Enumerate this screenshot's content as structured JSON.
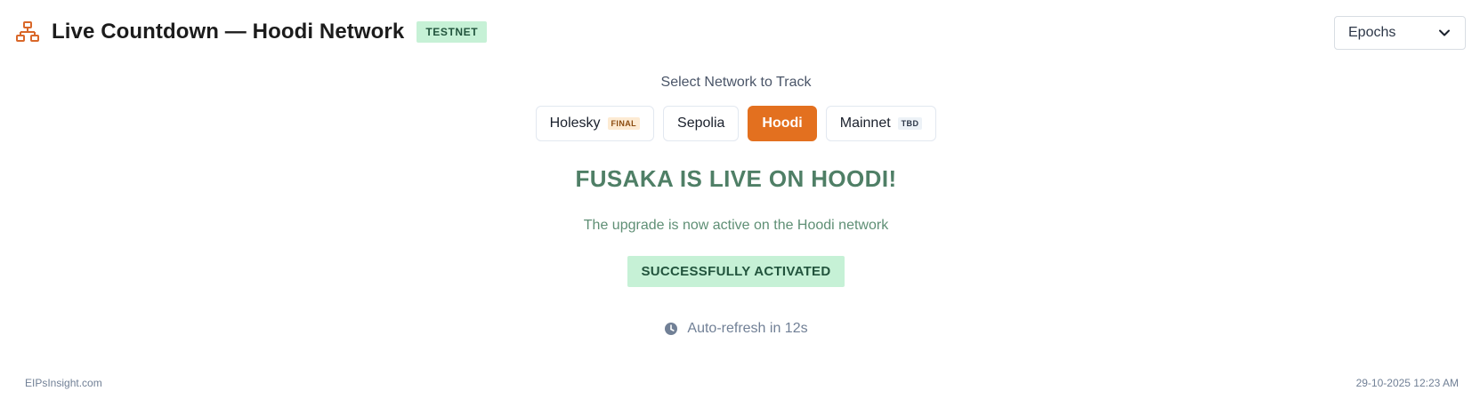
{
  "header": {
    "icon": "network-icon",
    "title": "Live Countdown — Hoodi Network",
    "badge": "TESTNET"
  },
  "units_select": {
    "selected": "Epochs",
    "icon": "chevron-down-icon"
  },
  "network_selector": {
    "label": "Select Network to Track",
    "networks": [
      {
        "name": "Holesky",
        "tag": "FINAL",
        "active": false
      },
      {
        "name": "Sepolia",
        "tag": "",
        "active": false
      },
      {
        "name": "Hoodi",
        "tag": "",
        "active": true
      },
      {
        "name": "Mainnet",
        "tag": "TBD",
        "active": false
      }
    ]
  },
  "status": {
    "heading": "FUSAKA IS LIVE ON HOODI!",
    "subtext": "The upgrade is now active on the Hoodi network",
    "badge": "SUCCESSFULLY ACTIVATED"
  },
  "refresh": {
    "icon": "clock-icon",
    "text": "Auto-refresh in 12s"
  },
  "footer": {
    "site": "EIPsInsight.com",
    "timestamp": "29-10-2025 12:23 AM"
  },
  "colors": {
    "accent": "#e3701f",
    "success_bg": "#c6f1d6",
    "success_text": "#22543d",
    "heading_green": "#4f7f66"
  }
}
